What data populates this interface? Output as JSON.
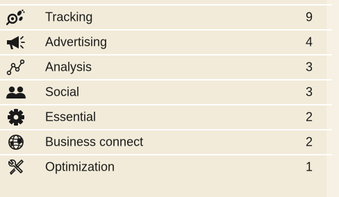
{
  "categories": [
    {
      "label": "Tracking",
      "count": "9",
      "icon": "footprints-lens-icon"
    },
    {
      "label": "Advertising",
      "count": "4",
      "icon": "megaphone-icon"
    },
    {
      "label": "Analysis",
      "count": "3",
      "icon": "line-graph-icon"
    },
    {
      "label": "Social",
      "count": "3",
      "icon": "people-icon"
    },
    {
      "label": "Essential",
      "count": "2",
      "icon": "gear-icon"
    },
    {
      "label": "Business connect",
      "count": "2",
      "icon": "globe-icon"
    },
    {
      "label": "Optimization",
      "count": "1",
      "icon": "tools-icon"
    }
  ],
  "colors": {
    "background": "#f2ebd9",
    "separator": "#ffffff",
    "icon": "#1a1a1a"
  }
}
